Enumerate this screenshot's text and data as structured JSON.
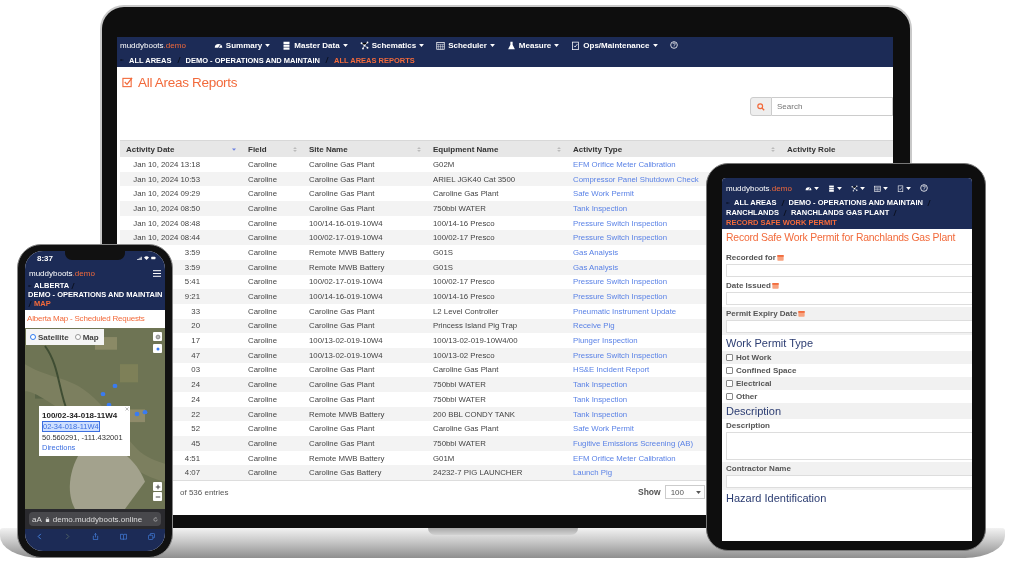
{
  "laptop": {
    "brand": {
      "name": "muddyboots",
      "suffix": ".demo"
    },
    "nav": [
      {
        "label": "Summary"
      },
      {
        "label": "Master Data"
      },
      {
        "label": "Schematics"
      },
      {
        "label": "Scheduler"
      },
      {
        "label": "Measure"
      },
      {
        "label": "Ops/Maintenance"
      }
    ],
    "breadcrumb": [
      {
        "label": "ALL AREAS",
        "current": false
      },
      {
        "label": "DEMO - OPERATIONS AND MAINTAIN",
        "current": false
      },
      {
        "label": "ALL AREAS REPORTS",
        "current": true
      }
    ],
    "title": "All Areas Reports",
    "search": {
      "placeholder": "Search"
    },
    "table": {
      "columns": [
        {
          "label": "Activity Date",
          "sorted": true
        },
        {
          "label": "Field",
          "sorted": false
        },
        {
          "label": "Site Name",
          "sorted": false
        },
        {
          "label": "Equipment Name",
          "sorted": false
        },
        {
          "label": "Activity Type",
          "sorted": false
        },
        {
          "label": "Activity Role"
        }
      ],
      "rows": [
        {
          "activity_date": "Jan 10, 2024 13:18",
          "field": "Caroline",
          "site_name": "Caroline Gas Plant",
          "equipment_name": "G02M",
          "activity_type": "EFM Orifice Meter Calibration"
        },
        {
          "activity_date": "Jan 10, 2024 10:53",
          "field": "Caroline",
          "site_name": "Caroline Gas Plant",
          "equipment_name": "ARIEL JGK40 Cat 3500",
          "activity_type": "Compressor Panel Shutdown Check"
        },
        {
          "activity_date": "Jan 10, 2024 09:29",
          "field": "Caroline",
          "site_name": "Caroline Gas Plant",
          "equipment_name": "Caroline Gas Plant",
          "activity_type": "Safe Work Permit"
        },
        {
          "activity_date": "Jan 10, 2024 08:50",
          "field": "Caroline",
          "site_name": "Caroline Gas Plant",
          "equipment_name": "750bbl WATER",
          "activity_type": "Tank Inspection"
        },
        {
          "activity_date": "Jan 10, 2024 08:48",
          "field": "Caroline",
          "site_name": "100/14-16-019-10W4",
          "equipment_name": "100/14-16 Presco",
          "activity_type": "Pressure Switch Inspection"
        },
        {
          "activity_date": "Jan 10, 2024 08:44",
          "field": "Caroline",
          "site_name": "100/02-17-019-10W4",
          "equipment_name": "100/02-17 Presco",
          "activity_type": "Pressure Switch Inspection"
        },
        {
          "activity_date": "3:59",
          "field": "Caroline",
          "site_name": "Remote MWB Battery",
          "equipment_name": "G01S",
          "activity_type": "Gas Analysis"
        },
        {
          "activity_date": "3:59",
          "field": "Caroline",
          "site_name": "Remote MWB Battery",
          "equipment_name": "G01S",
          "activity_type": "Gas Analysis"
        },
        {
          "activity_date": "5:41",
          "field": "Caroline",
          "site_name": "100/02-17-019-10W4",
          "equipment_name": "100/02-17 Presco",
          "activity_type": "Pressure Switch Inspection"
        },
        {
          "activity_date": "9:21",
          "field": "Caroline",
          "site_name": "100/14-16-019-10W4",
          "equipment_name": "100/14-16 Presco",
          "activity_type": "Pressure Switch Inspection"
        },
        {
          "activity_date": "33",
          "field": "Caroline",
          "site_name": "Caroline Gas Plant",
          "equipment_name": "L2 Level Controller",
          "activity_type": "Pneumatic Instrument Update"
        },
        {
          "activity_date": "20",
          "field": "Caroline",
          "site_name": "Caroline Gas Plant",
          "equipment_name": "Princess Island Pig Trap",
          "activity_type": "Receive Pig"
        },
        {
          "activity_date": "17",
          "field": "Caroline",
          "site_name": "100/13-02-019-10W4",
          "equipment_name": "100/13-02-019-10W4/00",
          "activity_type": "Plunger Inspection"
        },
        {
          "activity_date": "47",
          "field": "Caroline",
          "site_name": "100/13-02-019-10W4",
          "equipment_name": "100/13-02 Presco",
          "activity_type": "Pressure Switch Inspection"
        },
        {
          "activity_date": "03",
          "field": "Caroline",
          "site_name": "Caroline Gas Plant",
          "equipment_name": "Caroline Gas Plant",
          "activity_type": "HS&E Incident Report"
        },
        {
          "activity_date": "24",
          "field": "Caroline",
          "site_name": "Caroline Gas Plant",
          "equipment_name": "750bbl WATER",
          "activity_type": "Tank Inspection"
        },
        {
          "activity_date": "24",
          "field": "Caroline",
          "site_name": "Caroline Gas Plant",
          "equipment_name": "750bbl WATER",
          "activity_type": "Tank Inspection"
        },
        {
          "activity_date": "22",
          "field": "Caroline",
          "site_name": "Remote MWB Battery",
          "equipment_name": "200 BBL CONDY TANK",
          "activity_type": "Tank Inspection"
        },
        {
          "activity_date": "52",
          "field": "Caroline",
          "site_name": "Caroline Gas Plant",
          "equipment_name": "Caroline Gas Plant",
          "activity_type": "Safe Work Permit"
        },
        {
          "activity_date": "45",
          "field": "Caroline",
          "site_name": "Caroline Gas Plant",
          "equipment_name": "750bbl WATER",
          "activity_type": "Fugitive Emissions Screening (AB)"
        },
        {
          "activity_date": "4:51",
          "field": "Caroline",
          "site_name": "Remote MWB Battery",
          "equipment_name": "G01M",
          "activity_type": "EFM Orifice Meter Calibration"
        },
        {
          "activity_date": "4:07",
          "field": "Caroline",
          "site_name": "Caroline Gas Battery",
          "equipment_name": "24232-7 PIG LAUNCHER",
          "activity_type": "Launch Pig"
        }
      ]
    },
    "footer": {
      "entries": "of 536 entries",
      "show_label": "Show",
      "page_size": "100"
    }
  },
  "tablet": {
    "brand": {
      "name": "muddyboots",
      "suffix": ".demo"
    },
    "breadcrumb": [
      {
        "label": "ALL AREAS",
        "current": false
      },
      {
        "label": "DEMO - OPERATIONS AND MAINTAIN",
        "current": false
      },
      {
        "label": "RANCHLANDS",
        "current": false
      },
      {
        "label": "RANCHLANDS GAS PLANT",
        "current": false
      },
      {
        "label": "RECORD SAFE WORK PERMIT",
        "current": true
      }
    ],
    "title": "Record Safe Work Permit for Ranchlands Gas Plant",
    "form": [
      {
        "kind": "date-field",
        "label": "Recorded for"
      },
      {
        "kind": "date-field",
        "label": "Date Issued"
      },
      {
        "kind": "date-field",
        "label": "Permit Expiry Date"
      },
      {
        "kind": "heading",
        "label": "Work Permit Type"
      },
      {
        "kind": "checkbox",
        "label": "Hot Work",
        "checked": false
      },
      {
        "kind": "checkbox",
        "label": "Confined Space",
        "checked": false
      },
      {
        "kind": "checkbox",
        "label": "Electrical",
        "checked": false
      },
      {
        "kind": "checkbox",
        "label": "Other",
        "checked": false
      },
      {
        "kind": "heading",
        "label": "Description"
      },
      {
        "kind": "textarea",
        "label": "Description"
      },
      {
        "kind": "text-field",
        "label": "Contractor Name"
      },
      {
        "kind": "heading",
        "label": "Hazard Identification"
      }
    ]
  },
  "phone": {
    "time": "8:37",
    "brand": {
      "name": "muddyboots",
      "suffix": ".demo"
    },
    "breadcrumb": [
      {
        "label": "ALBERTA",
        "current": false
      },
      {
        "label": "DEMO - OPERATIONS AND MAINTAIN",
        "current": false
      },
      {
        "label": "MAP",
        "current": true
      }
    ],
    "title": "Alberta Map - Scheduled Requests",
    "map_types": [
      {
        "label": "Satellite",
        "selected": true
      },
      {
        "label": "Map",
        "selected": false
      }
    ],
    "popup": {
      "title": "100/02-34-018-11W4",
      "link": "02-34-018-11W4",
      "coordinates": "50.560291, -111.432001",
      "directions": "Directions"
    },
    "browser": {
      "text_size": "aA",
      "url": "demo.muddyboots.online"
    }
  }
}
